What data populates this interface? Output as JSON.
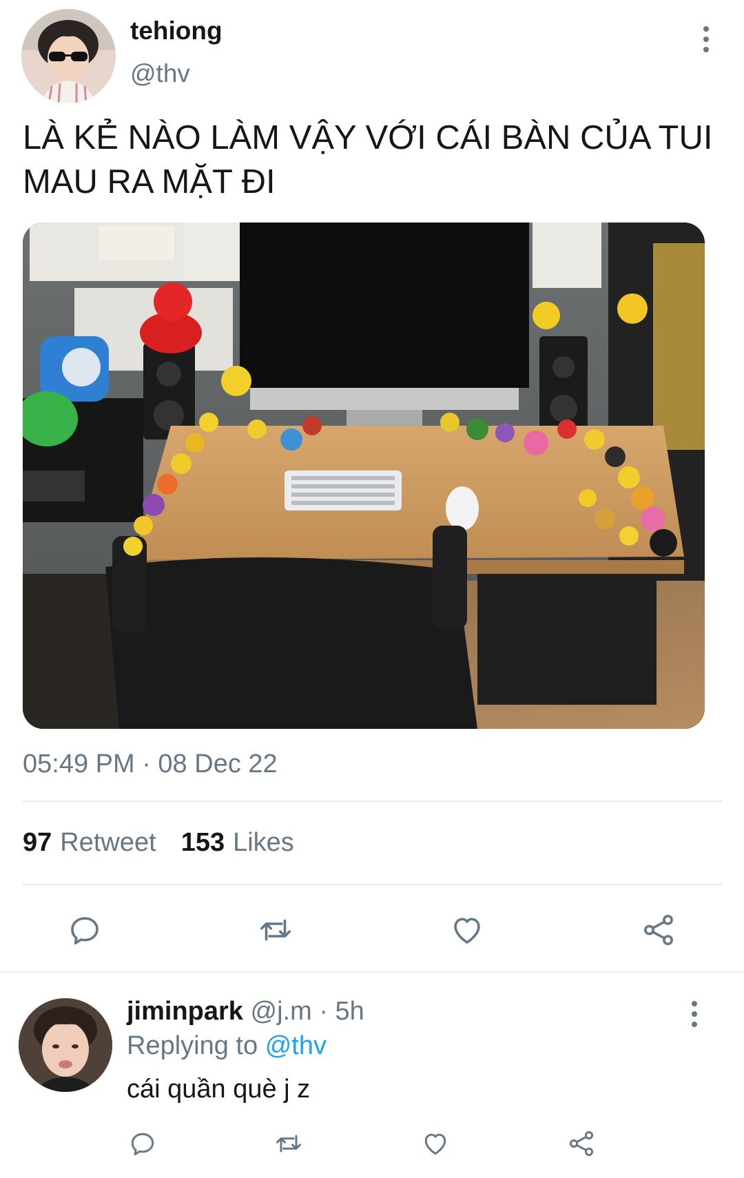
{
  "tweet": {
    "display_name": "tehiong",
    "handle": "@thv",
    "text": "LÀ KẺ NÀO LÀM VẬY VỚI CÁI BÀN CỦA TUI MAU RA MẶT ĐI",
    "timestamp": "05:49 PM · 08 Dec 22",
    "retweet_count": "97",
    "retweet_label": "Retweet",
    "like_count": "153",
    "like_label": "Likes",
    "media_icon": "photo-of-desk-with-rubber-ducks"
  },
  "reply": {
    "display_name": "jiminpark",
    "handle": "@j.m",
    "separator": "·",
    "time": "5h",
    "replying_prefix": "Replying to",
    "replying_to": "@thv",
    "text": "cái quần què j z"
  },
  "icons": {
    "more": "more-vertical-icon",
    "reply": "reply-icon",
    "retweet": "retweet-icon",
    "like": "heart-icon",
    "share": "share-icon"
  },
  "colors": {
    "text_primary": "#14171a",
    "text_secondary": "#657786",
    "link": "#1da1f2",
    "divider": "#e6ecf0"
  }
}
